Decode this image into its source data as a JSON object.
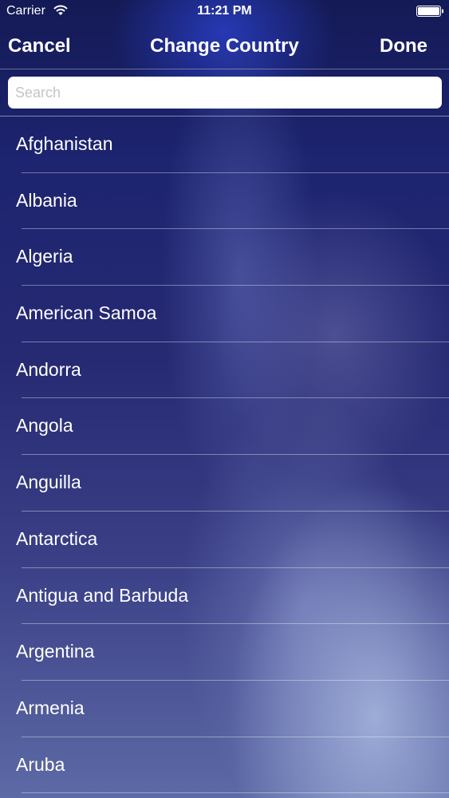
{
  "status_bar": {
    "carrier": "Carrier",
    "time": "11:21 PM",
    "wifi_icon": "wifi-icon",
    "battery_icon": "battery-icon"
  },
  "nav": {
    "cancel": "Cancel",
    "title": "Change Country",
    "done": "Done"
  },
  "search": {
    "placeholder": "Search",
    "value": ""
  },
  "countries": [
    "Afghanistan",
    "Albania",
    "Algeria",
    "American Samoa",
    "Andorra",
    "Angola",
    "Anguilla",
    "Antarctica",
    "Antigua and Barbuda",
    "Argentina",
    "Armenia",
    "Aruba"
  ],
  "colors": {
    "text": "#ffffff",
    "background_top": "#141a55",
    "background_bottom": "#5d6aa6",
    "search_field": "#ffffff",
    "search_placeholder": "#c4c4c8"
  }
}
